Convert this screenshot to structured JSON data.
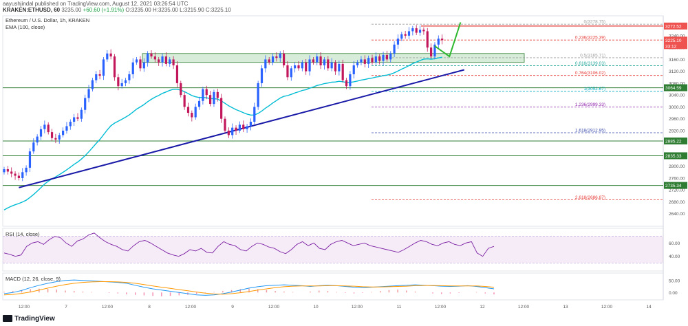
{
  "header": {
    "line1": "aayushjindal published on TradingView.com, August 12, 2021 03:26:54 UTC",
    "symbol": "KRAKEN:ETHUSD, 60",
    "last": "3235.00",
    "change": "+60.60 (+1.91%)",
    "ohlc": "O:3235.00 H:3235.00 L:3215.90 C:3225.10"
  },
  "footer": {
    "brand": "TradingView"
  },
  "colors": {
    "up": "#26a69a",
    "down": "#ef5350",
    "candle_up": "#2962ff",
    "candle_down": "#c2185b",
    "ema": "#00bcd4",
    "trend": "#1a1aa8",
    "level": "#2e7d32",
    "rsi": "#7b1fa2",
    "macd": "#2196f3",
    "signal": "#ff9800"
  },
  "chart_data": [
    {
      "type": "candlestick",
      "title": "Ethereum / U.S. Dollar, 1h, KRAKEN",
      "indicator_label": "EMA (100, close)",
      "ylim": [
        2600,
        3300
      ],
      "y_ticks": [
        "3240.00",
        "3200.00",
        "3160.00",
        "3120.00",
        "3080.00",
        "3040.00",
        "3000.00",
        "2960.00",
        "2920.00",
        "2880.00",
        "2840.00",
        "2800.00",
        "2760.00",
        "2720.00",
        "2680.00",
        "2640.00"
      ],
      "x_tick_labels": [
        "12:00",
        "7",
        "12:00",
        "8",
        "12:00",
        "9",
        "12:00",
        "10",
        "12:00",
        "11",
        "12:00",
        "12",
        "12:00",
        "13",
        "12:00",
        "14"
      ],
      "price_labels": [
        {
          "value": 3272.52,
          "text": "3272.52",
          "color": "#ef5350"
        },
        {
          "value": 3225.1,
          "text": "3225.10",
          "sub": "33:12",
          "color": "#ef5350"
        },
        {
          "value": 3064.59,
          "text": "3064.59",
          "color": "#2e7d32"
        },
        {
          "value": 2885.22,
          "text": "2885.22",
          "color": "#2e7d32"
        },
        {
          "value": 2835.33,
          "text": "2835.33",
          "color": "#2e7d32"
        },
        {
          "value": 2735.34,
          "text": "2735.34",
          "color": "#2e7d32"
        }
      ],
      "fib_levels": [
        {
          "value": 3278.75,
          "label": "0(3278.75)",
          "color": "#9e9e9e"
        },
        {
          "value": 3225.39,
          "label": "0.236(3225.39)",
          "color": "#e53935"
        },
        {
          "value": 3165.71,
          "label": "0.5(3165.71)",
          "color": "#9e9e9e"
        },
        {
          "value": 3139.03,
          "label": "0.618(3139.03)",
          "color": "#26a69a"
        },
        {
          "value": 3106.02,
          "label": "0.764(3106.02)",
          "color": "#e53935"
        },
        {
          "value": 3052.67,
          "label": "1(3052.67)",
          "color": "#00acc1"
        },
        {
          "value": 2999.33,
          "label": "1.236(2999.33)",
          "color": "#8e24aa"
        },
        {
          "value": 2912.95,
          "label": "1.618(2912.95)",
          "color": "#3949ab"
        },
        {
          "value": 2686.87,
          "label": "2.618(2686.87)",
          "color": "#e53935"
        }
      ],
      "horizontal_levels": [
        3064.59,
        2885.22,
        2835.33,
        2735.34,
        3272.52
      ],
      "resistance_zone": [
        3150,
        3180
      ],
      "trendline": {
        "from": {
          "bar": 4,
          "price": 2728
        },
        "to": {
          "bar": 125,
          "price": 3125
        }
      },
      "projection": [
        {
          "bar": 117,
          "price": 3205
        },
        {
          "bar": 121,
          "price": 3170
        },
        {
          "bar": 124,
          "price": 3285
        }
      ],
      "closes": [
        2790,
        2782,
        2775,
        2768,
        2760,
        2780,
        2795,
        2850,
        2880,
        2900,
        2925,
        2940,
        2915,
        2895,
        2890,
        2905,
        2920,
        2935,
        2950,
        2965,
        2960,
        2990,
        3030,
        3060,
        3090,
        3110,
        3105,
        3160,
        3180,
        3170,
        3100,
        3070,
        3080,
        3090,
        3110,
        3150,
        3160,
        3130,
        3150,
        3180,
        3170,
        3160,
        3150,
        3170,
        3145,
        3160,
        3140,
        3080,
        3040,
        3000,
        2980,
        2965,
        3000,
        3020,
        3060,
        3040,
        3010,
        3050,
        3030,
        2960,
        2920,
        2905,
        2930,
        2920,
        2940,
        2925,
        2935,
        2950,
        3000,
        3080,
        3130,
        3160,
        3150,
        3170,
        3165,
        3180,
        3140,
        3100,
        3130,
        3140,
        3130,
        3150,
        3120,
        3160,
        3150,
        3170,
        3140,
        3160,
        3130,
        3150,
        3120,
        3145,
        3090,
        3070,
        3110,
        3140,
        3150,
        3160,
        3145,
        3165,
        3150,
        3170,
        3155,
        3175,
        3160,
        3180,
        3210,
        3230,
        3245,
        3240,
        3255,
        3265,
        3250,
        3260,
        3255,
        3200,
        3170,
        3210,
        3230,
        3225
      ]
    },
    {
      "type": "line",
      "title": "RSI (14, close)",
      "ylim": [
        20,
        80
      ],
      "y_ticks": [
        "60.00",
        "40.00"
      ],
      "values": [
        45,
        43,
        40,
        42,
        55,
        60,
        62,
        58,
        65,
        70,
        68,
        60,
        55,
        63,
        66,
        72,
        75,
        68,
        62,
        58,
        55,
        50,
        48,
        56,
        62,
        64,
        60,
        55,
        50,
        45,
        42,
        40,
        44,
        50,
        48,
        52,
        46,
        45,
        55,
        62,
        58,
        56,
        50,
        48,
        55,
        60,
        58,
        54,
        52,
        47,
        44,
        50,
        58,
        62,
        56,
        60,
        52,
        50,
        58,
        62,
        64,
        60,
        56,
        58,
        60,
        56,
        54,
        52,
        50,
        48,
        46,
        50,
        55,
        60,
        64,
        62,
        58,
        56,
        60,
        62,
        58,
        56,
        60,
        62,
        45,
        40,
        52,
        55
      ]
    },
    {
      "type": "line",
      "title": "MACD (12, 26, close, 9)",
      "ylim": [
        -25,
        75
      ],
      "y_ticks": [
        "50.00",
        "0.00"
      ],
      "macd": [
        -5,
        0,
        8,
        20,
        30,
        38,
        45,
        50,
        52,
        50,
        48,
        46,
        44,
        42,
        38,
        30,
        22,
        15,
        10,
        5,
        0,
        -5,
        -10,
        -12,
        -10,
        -5,
        2,
        10,
        18,
        24,
        28,
        30,
        32,
        30,
        28,
        25,
        28,
        30,
        28,
        25,
        22,
        20,
        22,
        24,
        26,
        28,
        30,
        32,
        30,
        28,
        26,
        25,
        26,
        28,
        25,
        20,
        15
      ],
      "signal": [
        -10,
        -8,
        -4,
        2,
        10,
        18,
        26,
        33,
        38,
        42,
        44,
        45,
        45,
        44,
        42,
        38,
        33,
        27,
        22,
        17,
        12,
        7,
        2,
        -3,
        -6,
        -7,
        -5,
        -1,
        4,
        10,
        15,
        20,
        24,
        26,
        27,
        27,
        27,
        28,
        28,
        27,
        26,
        24,
        23,
        23,
        24,
        25,
        26,
        28,
        29,
        29,
        28,
        27,
        27,
        27,
        27,
        25,
        22
      ],
      "histogram": [
        3,
        6,
        10,
        14,
        16,
        15,
        12,
        8,
        6,
        4,
        2,
        0,
        -2,
        -4,
        -8,
        -10,
        -12,
        -14,
        -16,
        -14,
        -12,
        -10,
        -6,
        -2,
        2,
        6,
        10,
        14,
        16,
        14,
        10,
        6,
        4,
        2,
        0,
        4,
        8,
        6,
        2,
        -2,
        -4,
        -2,
        2,
        6,
        10,
        12,
        8,
        4,
        0,
        -4,
        -6,
        -4,
        -2,
        0,
        2,
        -4,
        -8
      ]
    }
  ]
}
